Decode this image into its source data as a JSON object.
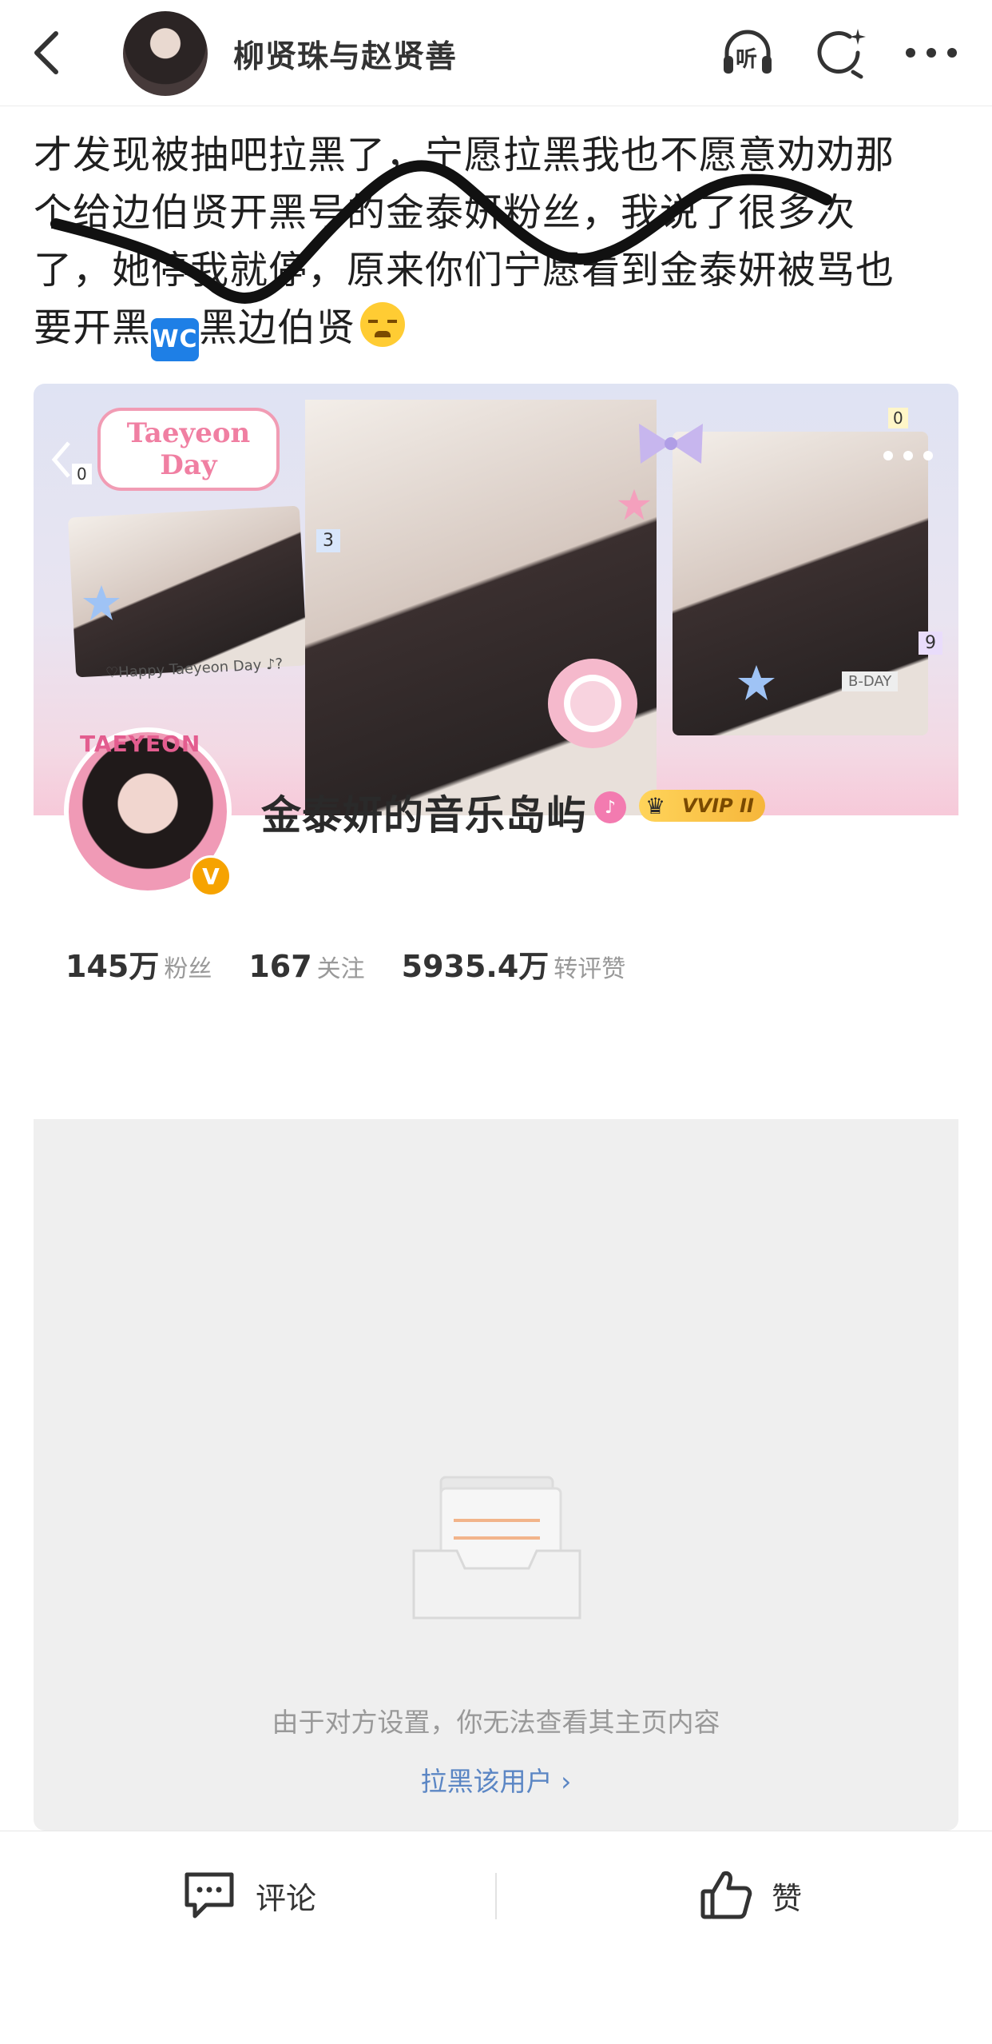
{
  "header": {
    "title": "柳贤珠与赵贤善",
    "listen_label": "听"
  },
  "post": {
    "text_line1": "才发现被抽吧拉黑了，宁愿拉黑我也不愿意劝劝那",
    "text_line2": "个给边伯贤开黑号的金泰妍粉丝，我说了很多次",
    "text_line3": "了，她停我就停，原来你们宁愿看到金泰妍被骂也",
    "text_line4_a": "要开黑",
    "wc_emoji": "🆖",
    "wc_label": "WC",
    "text_line4_b": "黑边伯贤",
    "emoji_end": "😭"
  },
  "profile_card": {
    "banner_text": "Taeyeon Day",
    "banner_caption": "♡Happy Taeyeon Day ♪?",
    "banner_tag": "B-DAY",
    "banner_number_a": "3",
    "banner_number_b": "9",
    "banner_number_c": "0",
    "banner_number_d": "0",
    "avatar_text": "TAEYEON",
    "name": "金泰妍的音乐岛屿",
    "vip_label": "VVIP II",
    "stats": [
      {
        "num": "145万",
        "label": "粉丝"
      },
      {
        "num": "167",
        "label": "关注"
      },
      {
        "num": "5935.4万",
        "label": "转评赞"
      }
    ],
    "blocked_message": "由于对方设置，你无法查看其主页内容",
    "block_link": "拉黑该用户 ›"
  },
  "actions": {
    "comment_label": "评论",
    "like_label": "赞"
  },
  "colors": {
    "link_blue": "#5b86c4",
    "vip_gold": "#f6b63b",
    "empty_bg": "#efefef"
  }
}
